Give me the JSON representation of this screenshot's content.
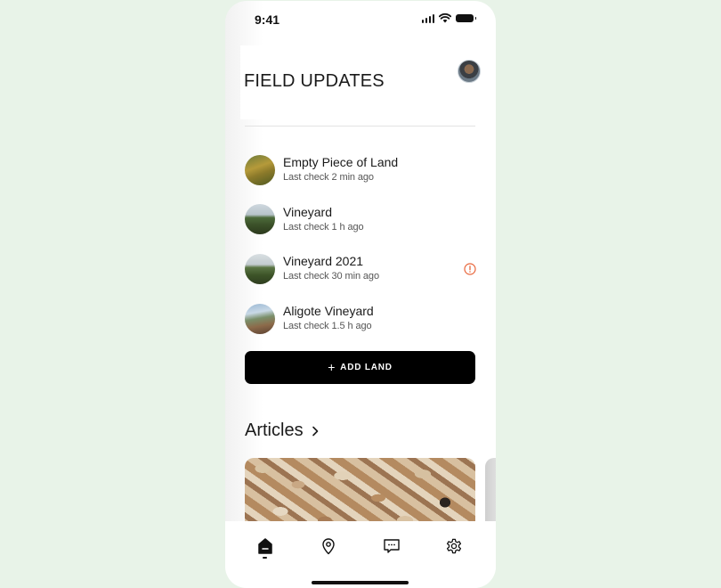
{
  "status_bar": {
    "time": "9:41",
    "icons": [
      "cellular-signal-icon",
      "wifi-icon",
      "battery-icon"
    ]
  },
  "header": {
    "title": "FIELD UPDATES",
    "avatar_icon": "user-avatar"
  },
  "lands": [
    {
      "name": "Empty Piece of Land",
      "last_check": "Last check 2 min ago",
      "thumbnail": "field-photo",
      "alert": false
    },
    {
      "name": "Vineyard",
      "last_check": "Last check 1 h ago",
      "thumbnail": "vineyard-photo",
      "alert": false
    },
    {
      "name": "Vineyard 2021",
      "last_check": "Last check 30 min ago",
      "thumbnail": "vineyard-photo",
      "alert": true
    },
    {
      "name": "Aligote Vineyard",
      "last_check": "Last check 1.5 h ago",
      "thumbnail": "hillside-vineyard-photo",
      "alert": false
    }
  ],
  "add_land": {
    "icon": "+",
    "label": "ADD LAND"
  },
  "articles": {
    "title": "Articles",
    "chevron_icon": "chevron-right-icon",
    "cards": [
      {
        "image": "wine-corks-photo"
      },
      {
        "image": "partial-next-card"
      }
    ]
  },
  "tab_bar": {
    "tabs": [
      {
        "name": "home",
        "icon": "home-icon",
        "active": true
      },
      {
        "name": "map",
        "icon": "map-pin-icon",
        "active": false
      },
      {
        "name": "messages",
        "icon": "chat-bubble-icon",
        "active": false
      },
      {
        "name": "settings",
        "icon": "gear-icon",
        "active": false
      }
    ]
  },
  "colors": {
    "background": "#e8f3e8",
    "primary_button": "#000000",
    "alert": "#e8653a",
    "text_primary": "#1a1a1a",
    "text_secondary": "#555555"
  }
}
